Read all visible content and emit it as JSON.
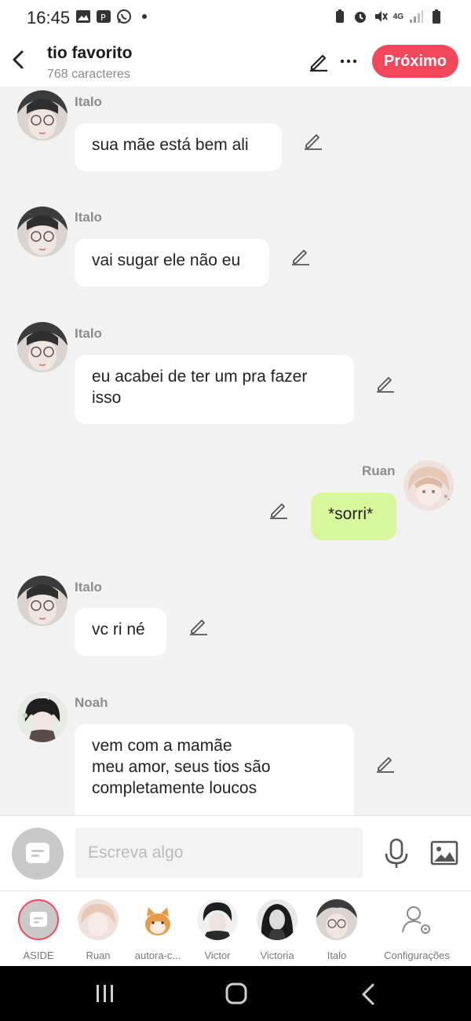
{
  "status": {
    "time": "16:45",
    "network": "4G"
  },
  "header": {
    "title": "tio favorito",
    "subtitle": "768 caracteres",
    "next_label": "Próximo"
  },
  "messages": [
    {
      "sender": "Italo",
      "text": "sua mãe está bem ali",
      "side": "left"
    },
    {
      "sender": "Italo",
      "text": "vai sugar ele não eu",
      "side": "left"
    },
    {
      "sender": "Italo",
      "text": "eu acabei de ter um pra fazer\nisso",
      "side": "left"
    },
    {
      "sender": "Ruan",
      "text": "*sorri*",
      "side": "right"
    },
    {
      "sender": "Italo",
      "text": "vc ri né",
      "side": "left"
    },
    {
      "sender": "Noah",
      "text": "vem com a mamãe\nmeu amor, seus tios são\ncompletamente loucos",
      "side": "left"
    }
  ],
  "input": {
    "placeholder": "Escreva algo"
  },
  "characters": [
    {
      "label": "ASIDE"
    },
    {
      "label": "Ruan"
    },
    {
      "label": "autora-c..."
    },
    {
      "label": "Victor"
    },
    {
      "label": "Victoria"
    },
    {
      "label": "Italo"
    },
    {
      "label": "Configurações"
    }
  ],
  "colors": {
    "accent": "#f2475a",
    "own_bubble": "#d9f79b",
    "other_bubble": "#ffffff",
    "background": "#f2f2f2"
  }
}
